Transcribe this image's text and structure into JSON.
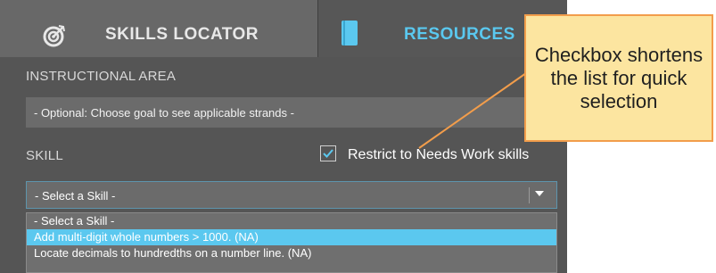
{
  "tabs": [
    {
      "label": "SKILLS LOCATOR",
      "icon": "target-icon"
    },
    {
      "label": "RESOURCES",
      "icon": "book-icon",
      "active": true
    }
  ],
  "instructional_area": {
    "label": "INSTRUCTIONAL AREA",
    "select_value": "- Optional: Choose goal to see applicable strands -"
  },
  "skill": {
    "label": "SKILL",
    "restrict_checkbox": {
      "checked": true,
      "label": "Restrict to Needs Work skills"
    },
    "select_value": "- Select a Skill -",
    "options": [
      "- Select a Skill -",
      "Add multi-digit whole numbers > 1000. (NA)",
      "Locate decimals to hundredths on a number line. (NA)"
    ],
    "highlighted_option": 1
  },
  "callout": {
    "text": "Checkbox shortens the list for quick selection"
  },
  "colors": {
    "accent": "#5bc8ef",
    "panel_bg": "#555555",
    "callout_bg": "#fce5a0",
    "callout_border": "#f29d4b"
  }
}
